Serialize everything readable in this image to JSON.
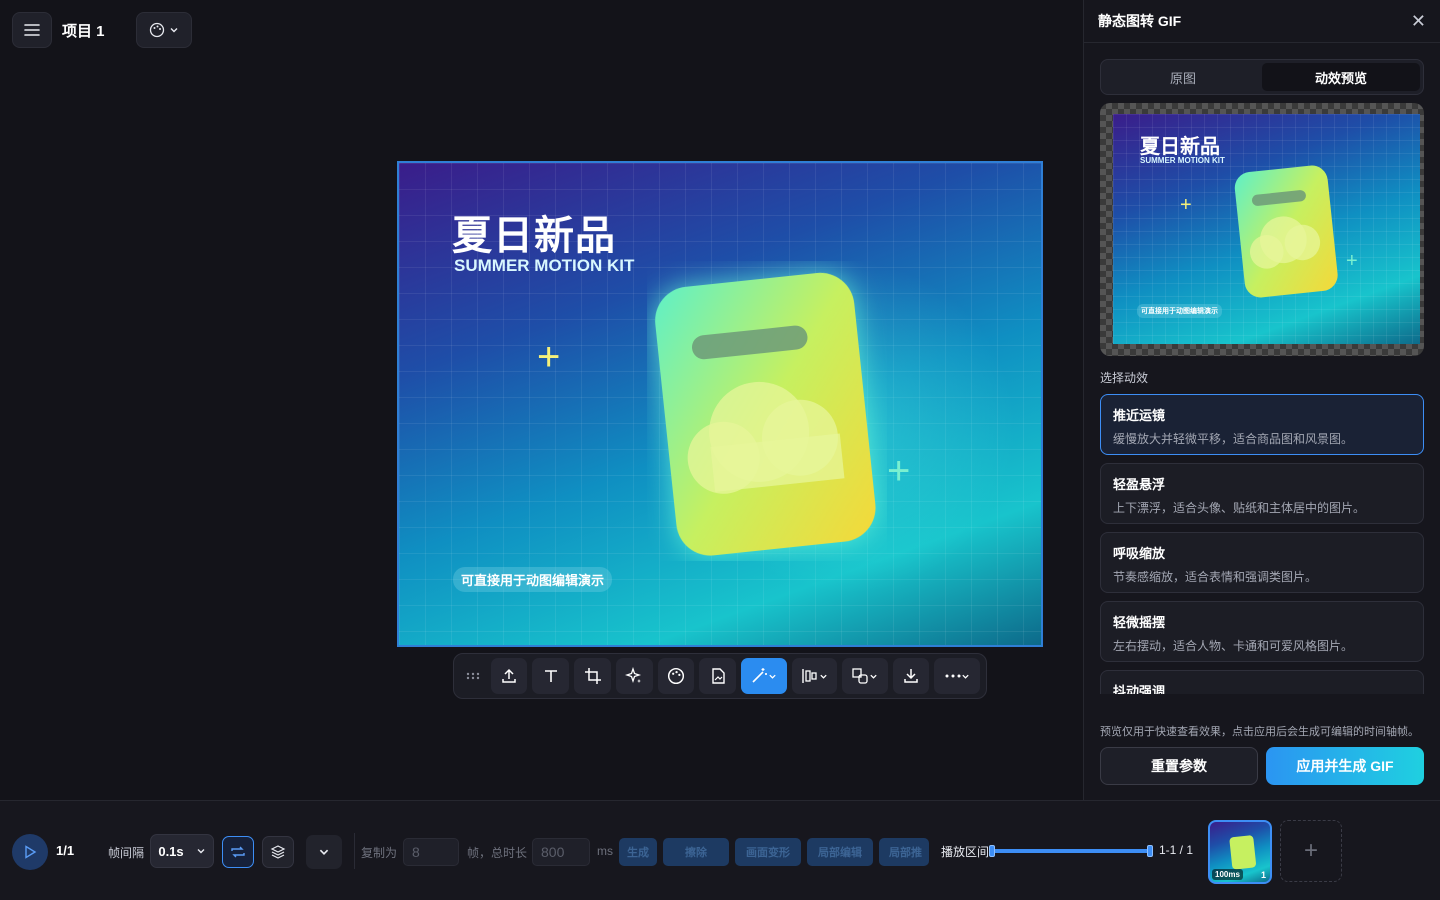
{
  "header": {
    "project_title": "项目 1"
  },
  "canvas": {
    "title": "夏日新品",
    "subtitle": "SUMMER MOTION KIT",
    "tag": "可直接用于动图编辑演示"
  },
  "panel": {
    "title": "静态图转 GIF",
    "tabs": [
      {
        "label": "原图",
        "active": false
      },
      {
        "label": "动效预览",
        "active": true
      }
    ],
    "section_label": "选择动效",
    "effects": [
      {
        "name": "推近运镜",
        "desc": "缓慢放大并轻微平移，适合商品图和风景图。",
        "selected": true
      },
      {
        "name": "轻盈悬浮",
        "desc": "上下漂浮，适合头像、贴纸和主体居中的图片。",
        "selected": false
      },
      {
        "name": "呼吸缩放",
        "desc": "节奏感缩放，适合表情和强调类图片。",
        "selected": false
      },
      {
        "name": "轻微摇摆",
        "desc": "左右摆动，适合人物、卡通和可爱风格图片。",
        "selected": false
      },
      {
        "name": "抖动强调",
        "desc": "",
        "selected": false
      }
    ],
    "note": "预览仅用于快速查看效果，点击应用后会生成可编辑的时间轴帧。",
    "reset_label": "重置参数",
    "apply_label": "应用并生成 GIF"
  },
  "bottom": {
    "frame_counter": "1/1",
    "interval_label": "帧间隔",
    "interval_value": "0.1s",
    "copy_label": "复制为",
    "copy_value": "8",
    "total_label": "帧，总时长",
    "total_value": "800",
    "ms_label": "ms",
    "action_buttons": [
      "生成",
      "擦除",
      "画面变形",
      "局部编辑",
      "局部推"
    ],
    "range_label": "播放区间",
    "range_value": "1-1 / 1",
    "frame_duration": "100ms",
    "frame_index": "1"
  },
  "colors": {
    "accent": "#3d8ef5",
    "apply_gradient_start": "#2b95f2",
    "apply_gradient_end": "#1fd0e0",
    "background": "#131319"
  }
}
